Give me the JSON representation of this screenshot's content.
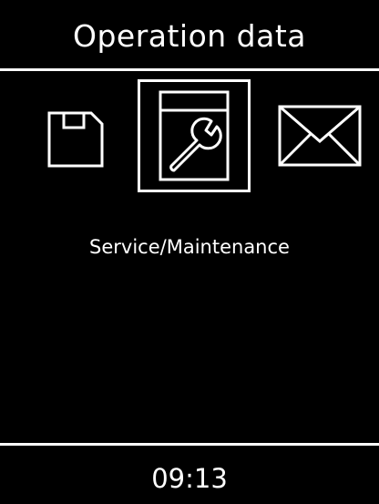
{
  "header": {
    "title": "Operation data"
  },
  "menu": {
    "items": [
      {
        "icon": "floppy-disk-icon",
        "selected": false
      },
      {
        "icon": "wrench-icon",
        "selected": true
      },
      {
        "icon": "envelope-icon",
        "selected": false
      }
    ],
    "selected_label": "Service/Maintenance"
  },
  "footer": {
    "time": "09:13"
  },
  "colors": {
    "background": "#000000",
    "foreground": "#ffffff"
  }
}
